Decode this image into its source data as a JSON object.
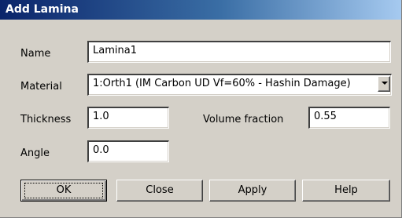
{
  "window": {
    "title": "Add Lamina"
  },
  "form": {
    "name_label": "Name",
    "name_value": "Lamina1",
    "material_label": "Material",
    "material_value": "1:Orth1 (IM Carbon UD Vf=60% - Hashin Damage)",
    "thickness_label": "Thickness",
    "thickness_value": "1.0",
    "volume_fraction_label": "Volume fraction",
    "volume_fraction_value": "0.55",
    "angle_label": "Angle",
    "angle_value": "0.0"
  },
  "buttons": {
    "ok": "OK",
    "close": "Close",
    "apply": "Apply",
    "help": "Help"
  },
  "icons": {
    "dropdown": "chevron-down-icon"
  },
  "colors": {
    "title_start": "#0a246a",
    "title_end": "#a6caf0",
    "dialog_bg": "#d4d0c8"
  }
}
